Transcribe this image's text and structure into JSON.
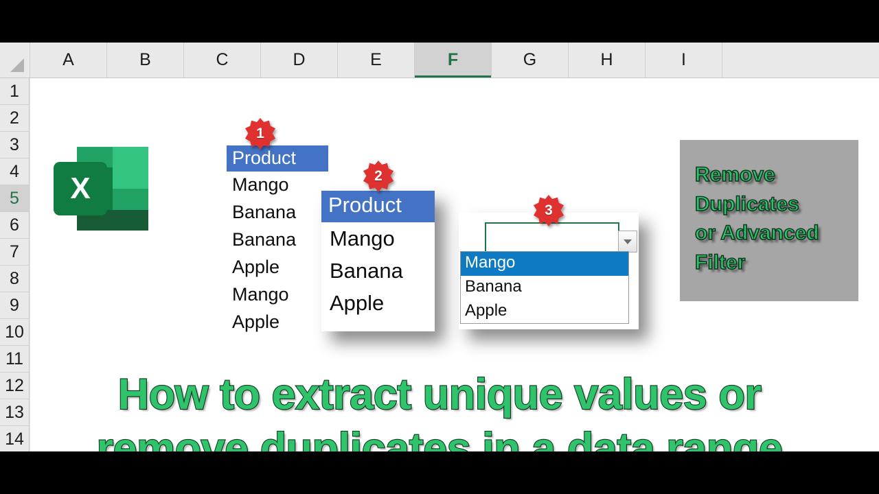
{
  "app": {
    "logo_letter": "X",
    "logo_name": "excel-logo"
  },
  "sheet": {
    "columns": [
      "A",
      "B",
      "C",
      "D",
      "E",
      "F",
      "G",
      "H",
      "I"
    ],
    "selected_column": "F",
    "rows": [
      "1",
      "2",
      "3",
      "4",
      "5",
      "6",
      "7",
      "8",
      "9",
      "10",
      "11",
      "12",
      "13",
      "14"
    ],
    "selected_row": "5"
  },
  "source_list": {
    "header": "Product",
    "items": [
      "Mango",
      "Banana",
      "Banana",
      "Apple",
      "Mango",
      "Apple"
    ]
  },
  "unique_list": {
    "header": "Product",
    "items": [
      "Mango",
      "Banana",
      "Apple"
    ]
  },
  "dropdown": {
    "value": "",
    "placeholder": "",
    "arrow_icon": "chevron-down-icon",
    "options": [
      "Mango",
      "Banana",
      "Apple"
    ],
    "selected_option": "Mango"
  },
  "callout": {
    "text": "Remove\nDuplicates\nor Advanced\nFilter"
  },
  "headline": {
    "text": "How to extract unique values or\nremove duplicates in a data range"
  },
  "badges": {
    "one": "1",
    "two": "2",
    "three": "3"
  },
  "colors": {
    "header_blue": "#4472C4",
    "dropdown_highlight": "#0F7AC4",
    "excel_green": "#217346",
    "accent_green_text": "#2FC36B",
    "text_outline": "#123B22",
    "callout_bg": "#A6A6A6",
    "badge_red": "#E03131",
    "letterbox": "#000000"
  }
}
